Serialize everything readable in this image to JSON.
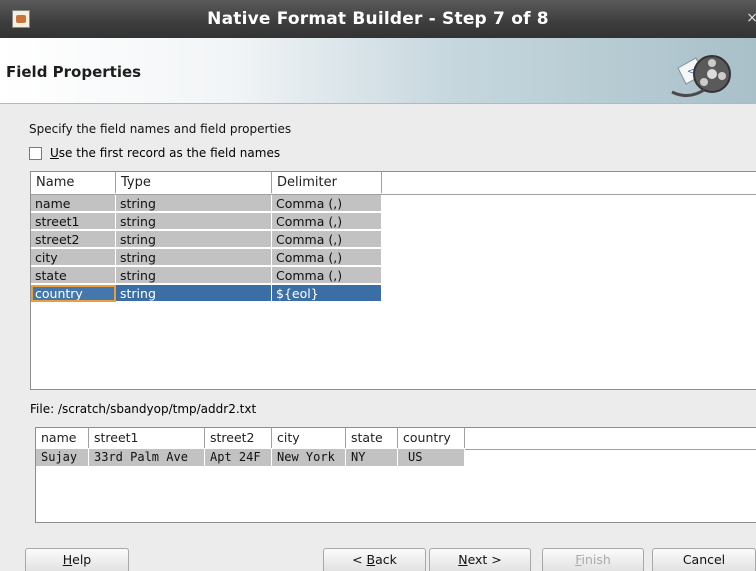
{
  "window": {
    "title": "Native Format Builder - Step 7 of 8",
    "close_glyph": "×"
  },
  "header": {
    "title": "Field Properties"
  },
  "content": {
    "instruction": "Specify the field names and field properties",
    "checkbox": {
      "mnemonic": "U",
      "label_rest": "se the first record as the field names",
      "checked": false
    }
  },
  "fields_table": {
    "columns": [
      "Name",
      "Type",
      "Delimiter"
    ],
    "rows": [
      {
        "name": "name",
        "type": "string",
        "delimiter": "Comma (,)"
      },
      {
        "name": "street1",
        "type": "string",
        "delimiter": "Comma (,)"
      },
      {
        "name": "street2",
        "type": "string",
        "delimiter": "Comma (,)"
      },
      {
        "name": "city",
        "type": "string",
        "delimiter": "Comma (,)"
      },
      {
        "name": "state",
        "type": "string",
        "delimiter": "Comma (,)"
      },
      {
        "name": "country",
        "type": "string",
        "delimiter": "${eol}"
      }
    ],
    "selected_row": "country"
  },
  "file": {
    "label": "File: /scratch/sbandyop/tmp/addr2.txt"
  },
  "preview_table": {
    "columns": [
      "name",
      "street1",
      "street2",
      "city",
      "state",
      "country"
    ],
    "rows": [
      [
        "Sujay",
        "33rd Palm Ave",
        "Apt 24F",
        "New York",
        "NY",
        "US"
      ]
    ]
  },
  "buttons": {
    "help": {
      "mnemonic": "H",
      "rest": "elp"
    },
    "back": {
      "prefix": "< ",
      "mnemonic": "B",
      "rest": "ack"
    },
    "next": {
      "mnemonic": "N",
      "rest": "ext >"
    },
    "finish": {
      "mnemonic": "F",
      "rest": "inish",
      "enabled": false
    },
    "cancel": {
      "label": "Cancel"
    }
  },
  "colors": {
    "selection": "#3b6ea5",
    "row_bg": "#c2c2c2",
    "focus_outline": "#e8a13a"
  }
}
